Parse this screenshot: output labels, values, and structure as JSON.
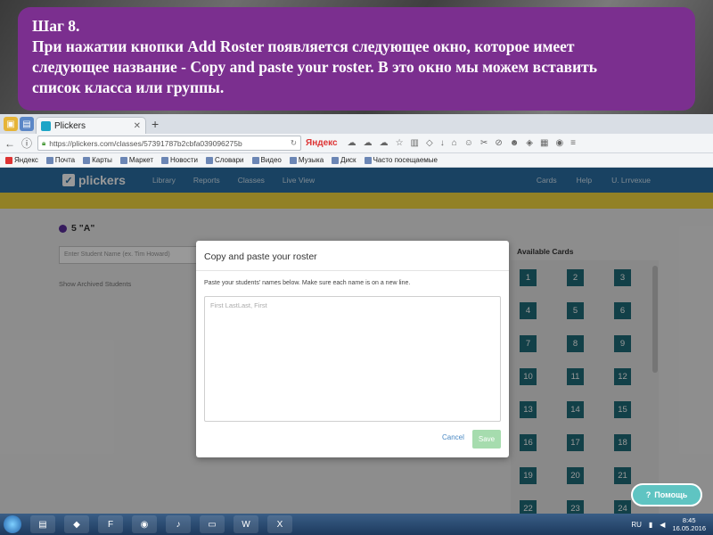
{
  "banner": {
    "lines": [
      "Шаг 8.",
      "При нажатии кнопки Add Roster появляется следующее окно, которое имеет",
      "следующее название - Copy and paste your roster. В это окно мы можем вставить",
      "список класса или группы."
    ]
  },
  "browser": {
    "tab_title": "Plickers",
    "url": "https://plickers.com/classes/57391787b2cbfa039096275b",
    "search_engine": "Яндекс",
    "bookmarks": [
      "Яндекс",
      "Почта",
      "Карты",
      "Маркет",
      "Новости",
      "Словари",
      "Видео",
      "Музыка",
      "Диск",
      "Часто посещаемые"
    ]
  },
  "site": {
    "logo": "plickers",
    "nav": [
      "Library",
      "Reports",
      "Classes",
      "Live View"
    ],
    "nav_right": [
      "Cards",
      "Help",
      "U. Lrrvexue"
    ],
    "class_name": "5 \"A\"",
    "student_placeholder": "Enter Student Name (ex. Tim Howard)",
    "show_archived": "Show Archived Students",
    "available_cards_title": "Available Cards",
    "cards": [
      "1",
      "2",
      "3",
      "4",
      "5",
      "6",
      "7",
      "8",
      "9",
      "10",
      "11",
      "12",
      "13",
      "14",
      "15",
      "16",
      "17",
      "18",
      "19",
      "20",
      "21",
      "22",
      "23",
      "24"
    ],
    "help_button": "Помощь",
    "colors": {
      "nav": "#2b6fa3",
      "banner": "#f4d73f",
      "card": "#1f6b78",
      "class_dot": "#5b2d9c"
    }
  },
  "modal": {
    "title": "Copy and paste your roster",
    "instruction": "Paste your students' names below. Make sure each name is on a new line.",
    "textarea_placeholder": "First LastLast, First",
    "cancel_label": "Cancel",
    "save_label": "Save"
  },
  "taskbar": {
    "language": "RU",
    "time": "8:45",
    "date": "16.05.2016"
  }
}
